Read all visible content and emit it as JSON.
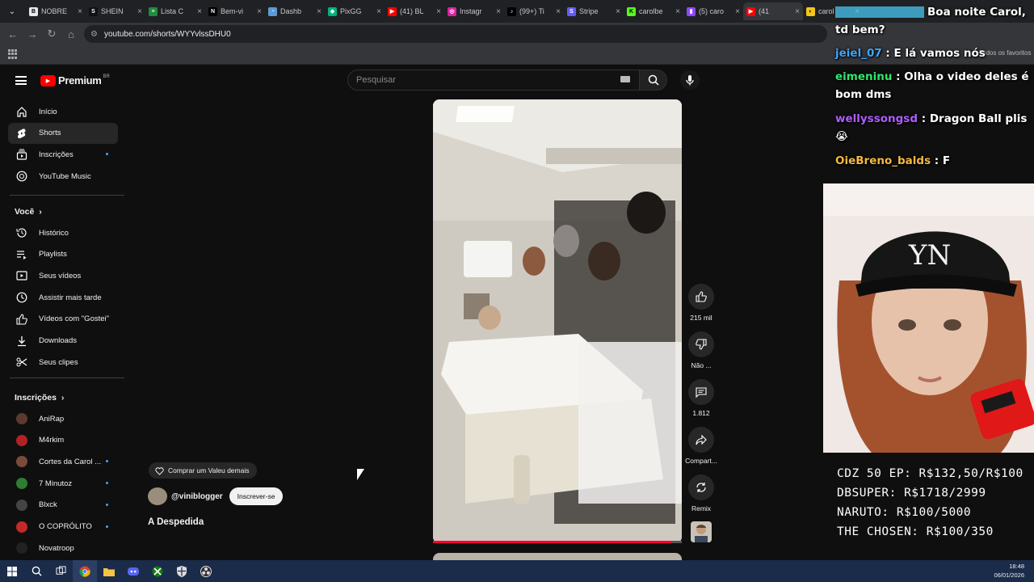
{
  "browser": {
    "tabs": [
      {
        "label": "NOBRE",
        "color": "#e8e8e8",
        "glyph": "B",
        "fg": "#000"
      },
      {
        "label": "SHEIN",
        "color": "#111111",
        "glyph": "S",
        "fg": "#fff"
      },
      {
        "label": "Lista C",
        "color": "#1e8e3e",
        "glyph": "≡",
        "fg": "#fff"
      },
      {
        "label": "Bem-vi",
        "color": "#000000",
        "glyph": "N",
        "fg": "#fff"
      },
      {
        "label": "Dashb",
        "color": "#5b9bd5",
        "glyph": "◔",
        "fg": "#fff"
      },
      {
        "label": "PixGG",
        "color": "#00b37e",
        "glyph": "◆",
        "fg": "#fff"
      },
      {
        "label": "(41) BL",
        "color": "#ff0000",
        "glyph": "▶",
        "fg": "#fff"
      },
      {
        "label": "Instagr",
        "color": "#d6249f",
        "glyph": "◎",
        "fg": "#fff"
      },
      {
        "label": "(99+) Ti",
        "color": "#000000",
        "glyph": "♪",
        "fg": "#fff"
      },
      {
        "label": "Stripe",
        "color": "#635bff",
        "glyph": "S",
        "fg": "#fff"
      },
      {
        "label": "carolbe",
        "color": "#53fc18",
        "glyph": "K",
        "fg": "#000"
      },
      {
        "label": "(5) caro",
        "color": "#9146ff",
        "glyph": "▮",
        "fg": "#fff"
      },
      {
        "label": "(41",
        "color": "#ff0000",
        "glyph": "▶",
        "fg": "#fff",
        "active": true
      },
      {
        "label": "carol",
        "color": "#f5c518",
        "glyph": "◐",
        "fg": "#000"
      }
    ],
    "url": "youtube.com/shorts/WYYvlssDHU0",
    "all_bookmarks": "Todos os favoritos"
  },
  "youtube": {
    "logo_text": "Premium",
    "logo_region": "BR",
    "search_placeholder": "Pesquisar",
    "sidebar_top": [
      {
        "label": "Início",
        "icon": "home-icon"
      },
      {
        "label": "Shorts",
        "icon": "shorts-icon",
        "selected": true
      },
      {
        "label": "Inscrições",
        "icon": "subscriptions-icon",
        "dot": true
      },
      {
        "label": "YouTube Music",
        "icon": "music-icon"
      }
    ],
    "you_section": "Você",
    "sidebar_you": [
      {
        "label": "Histórico",
        "icon": "history-icon"
      },
      {
        "label": "Playlists",
        "icon": "playlists-icon"
      },
      {
        "label": "Seus vídeos",
        "icon": "your-videos-icon"
      },
      {
        "label": "Assistir mais tarde",
        "icon": "watch-later-icon"
      },
      {
        "label": "Vídeos com \"Gostei\"",
        "icon": "liked-icon"
      },
      {
        "label": "Downloads",
        "icon": "download-icon"
      },
      {
        "label": "Seus clipes",
        "icon": "clips-icon"
      }
    ],
    "subs_section": "Inscrições",
    "subscriptions": [
      {
        "label": "AniRap",
        "color": "#5a3b2e"
      },
      {
        "label": "M4rkim",
        "color": "#b22222"
      },
      {
        "label": "Cortes da Carol ...",
        "color": "#7a4b3a",
        "dot": true
      },
      {
        "label": "7 Minutoz",
        "color": "#2e7d32",
        "dot": true
      },
      {
        "label": "Blxck",
        "color": "#444444",
        "dot": true
      },
      {
        "label": "O COPRÓLITO",
        "color": "#c62828",
        "dot": true
      },
      {
        "label": "Novatroop",
        "color": "#222222"
      }
    ],
    "short": {
      "buy_chip": "Comprar um Valeu demais",
      "channel": "@viniblogger",
      "subscribe": "Inscrever-se",
      "title": "A Despedida",
      "likes": "215 mil",
      "dislike": "Não ...",
      "comments": "1.812",
      "share": "Compart...",
      "remix": "Remix",
      "progress": 0.96
    }
  },
  "stream_overlay": {
    "chat": [
      {
        "user": "",
        "text": "Boa noite Carol, td bem?",
        "color": "#4ad1ff"
      },
      {
        "user": "jeiel_07",
        "text": "E lá vamos nós",
        "color": "#3ea6ff"
      },
      {
        "user": "eimeninu",
        "text": "Olha o video deles é bom dms",
        "color": "#2ee86b"
      },
      {
        "user": "wellyssongsd",
        "text": "Dragon Ball plis 😭",
        "color": "#b15cff"
      },
      {
        "user": "OieBreno_balds",
        "text": "F",
        "color": "#f5b942"
      }
    ],
    "goals": [
      "CDZ 50 EP: R$132,50/R$100",
      "DBSUPER: R$1718/2999",
      "NARUTO: R$100/5000",
      "THE CHOSEN: R$100/350"
    ]
  },
  "taskbar": {
    "time": "18:48",
    "date": "06/01/2026"
  }
}
